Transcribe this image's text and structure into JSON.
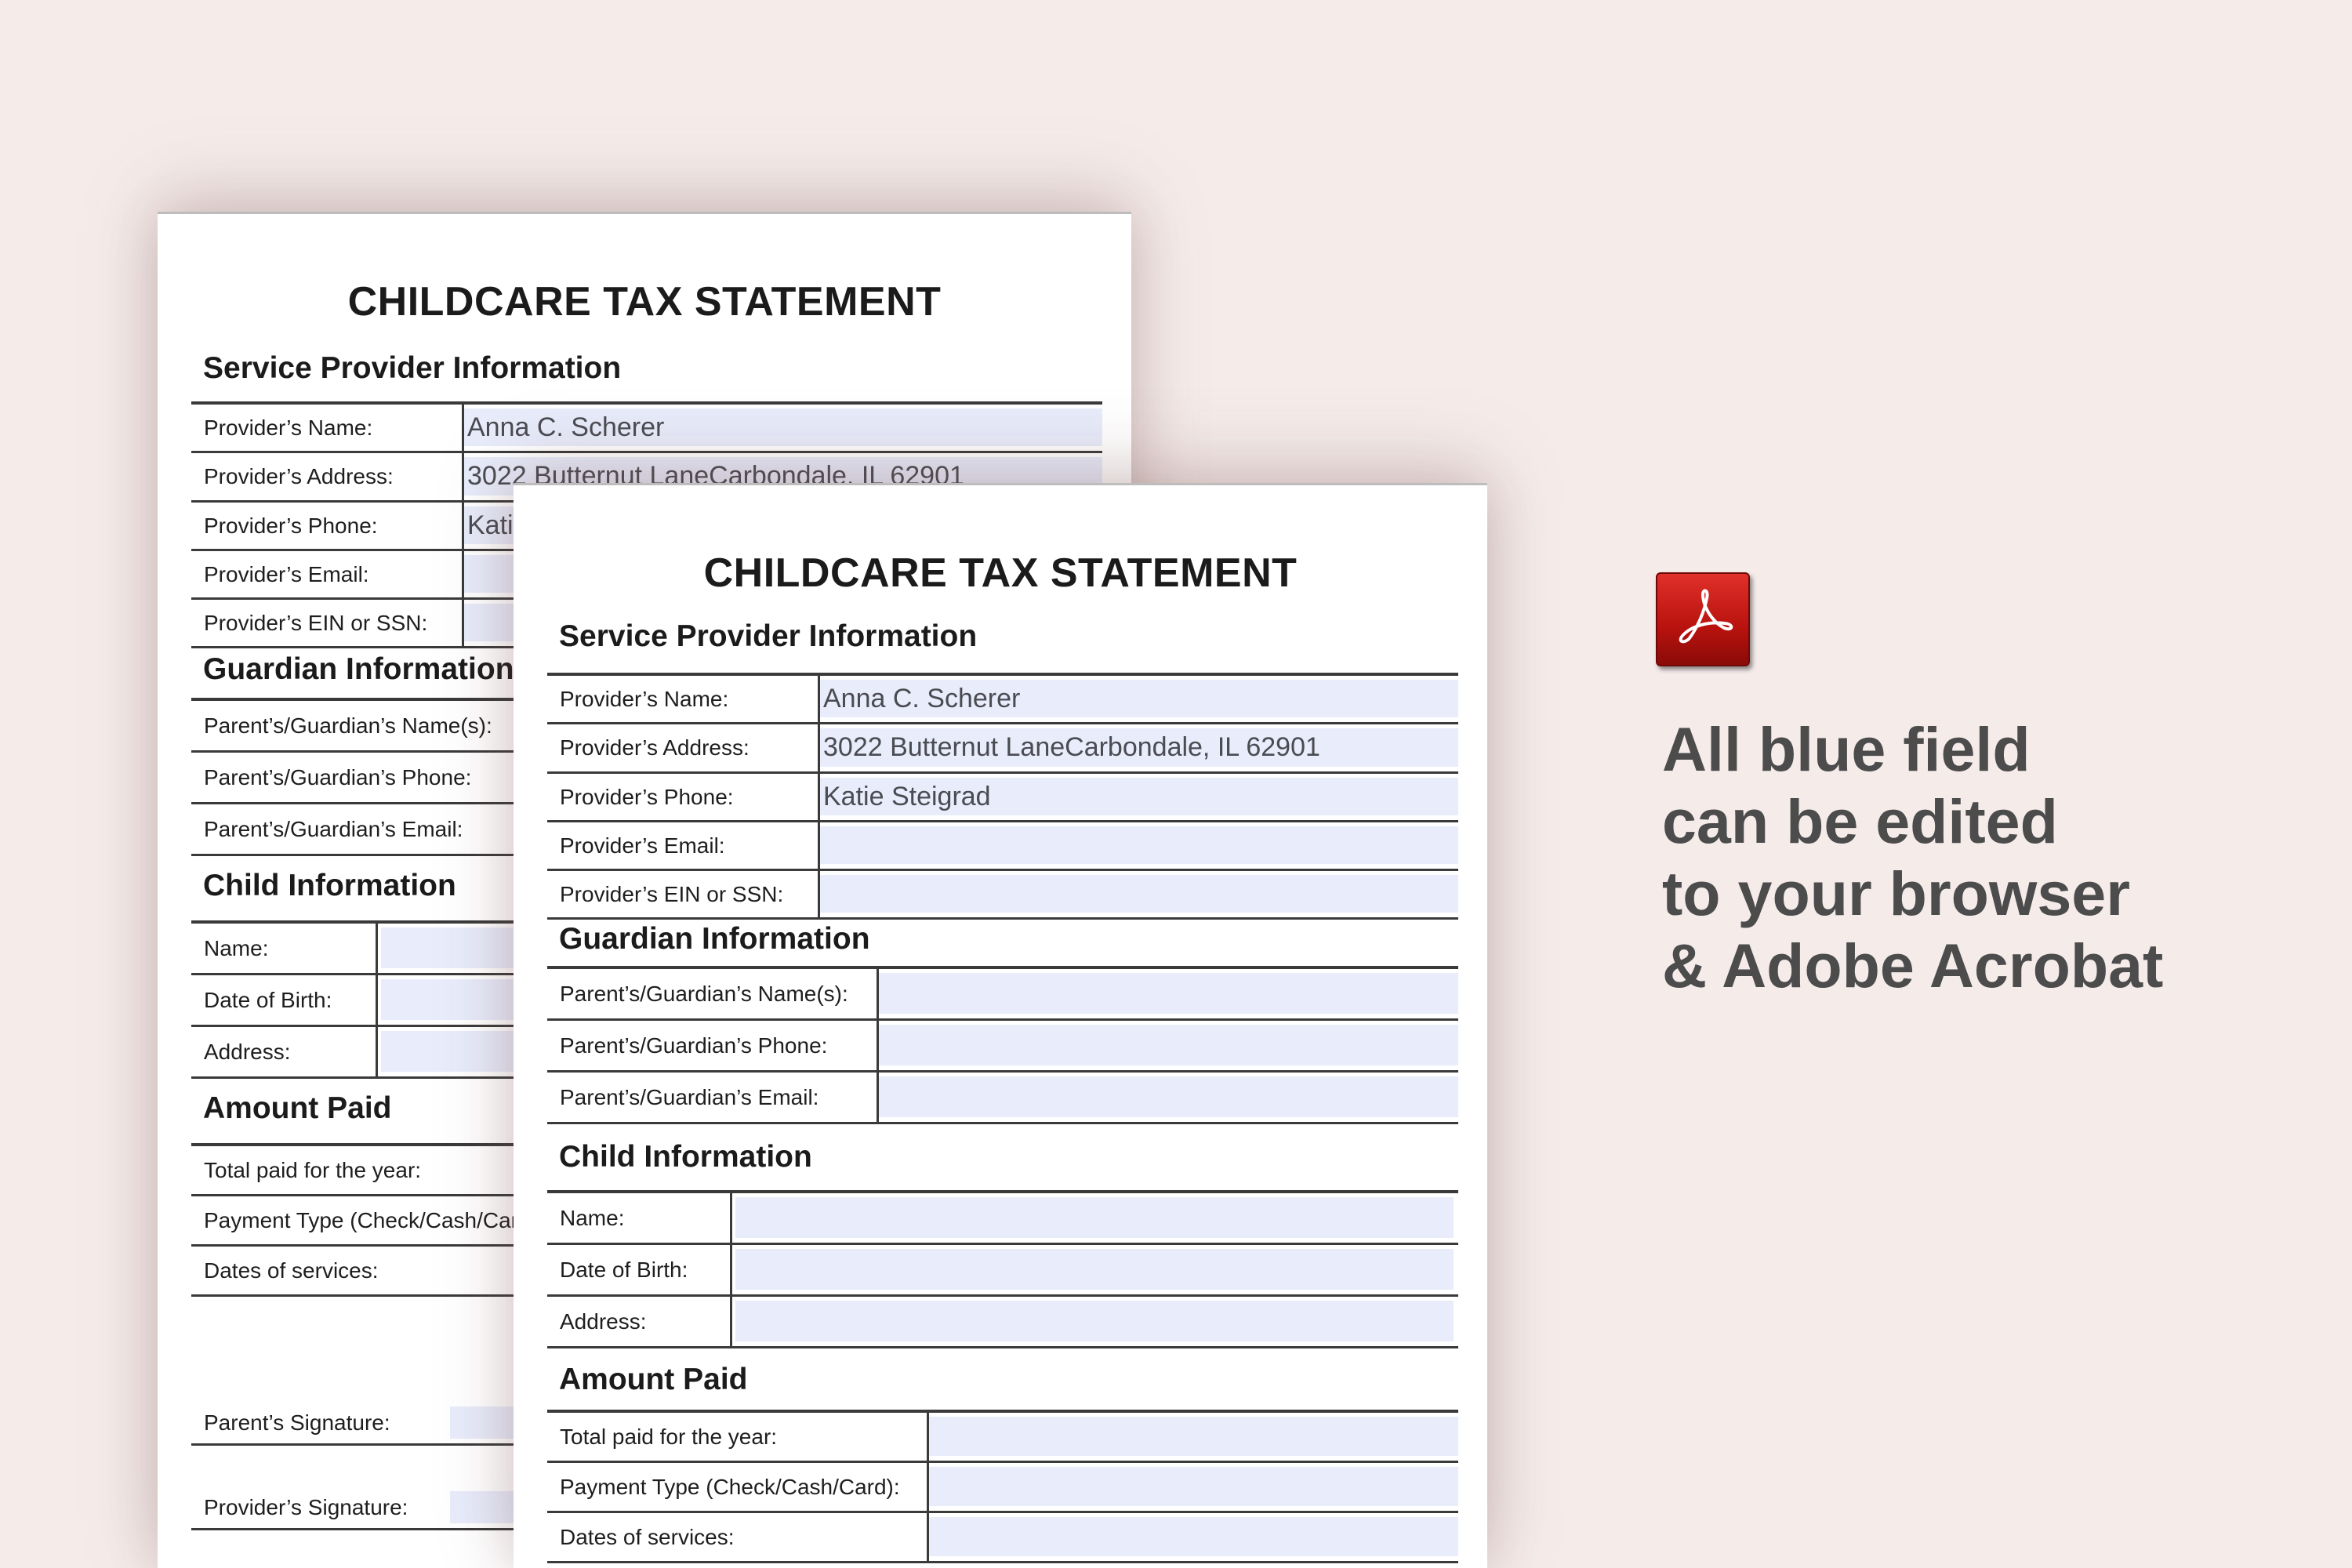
{
  "form": {
    "title": "CHILDCARE TAX STATEMENT",
    "sections": {
      "provider": "Service Provider Information",
      "guardian": "Guardian Information",
      "child": "Child Information",
      "amount": "Amount Paid"
    },
    "provider_fields": [
      {
        "label": "Provider’s Name:",
        "value": "Anna C. Scherer"
      },
      {
        "label": "Provider’s Address:",
        "value": "3022 Butternut LaneCarbondale, IL 62901"
      },
      {
        "label": "Provider’s Phone:",
        "value": "Katie Steigrad"
      },
      {
        "label": "Provider’s Email:",
        "value": ""
      },
      {
        "label": "Provider’s EIN or SSN:",
        "value": ""
      }
    ],
    "guardian_fields": [
      {
        "label": "Parent’s/Guardian’s Name(s):",
        "value": ""
      },
      {
        "label": "Parent’s/Guardian’s Phone:",
        "value": ""
      },
      {
        "label": "Parent’s/Guardian’s Email:",
        "value": ""
      }
    ],
    "child_fields": [
      {
        "label": "Name:",
        "value": ""
      },
      {
        "label": "Date of Birth:",
        "value": ""
      },
      {
        "label": "Address:",
        "value": ""
      }
    ],
    "amount_fields": [
      {
        "label": "Total paid for the year:",
        "value": ""
      },
      {
        "label": "Payment Type (Check/Cash/Card):",
        "value": ""
      },
      {
        "label": "Dates of services:",
        "value": ""
      }
    ],
    "signatures": [
      {
        "label": "Parent’s Signature:",
        "value": ""
      },
      {
        "label": "Provider’s Signature:",
        "value": ""
      }
    ]
  },
  "promo": {
    "lines": [
      "All blue field",
      "can be edited",
      "to your browser",
      "& Adobe Acrobat"
    ],
    "icon": "adobe-acrobat-icon",
    "text_color": "#4c4c4c",
    "icon_color": "#c4150f"
  },
  "colors": {
    "background": "#f5ecea",
    "field_fill": "#e8ecfb"
  }
}
